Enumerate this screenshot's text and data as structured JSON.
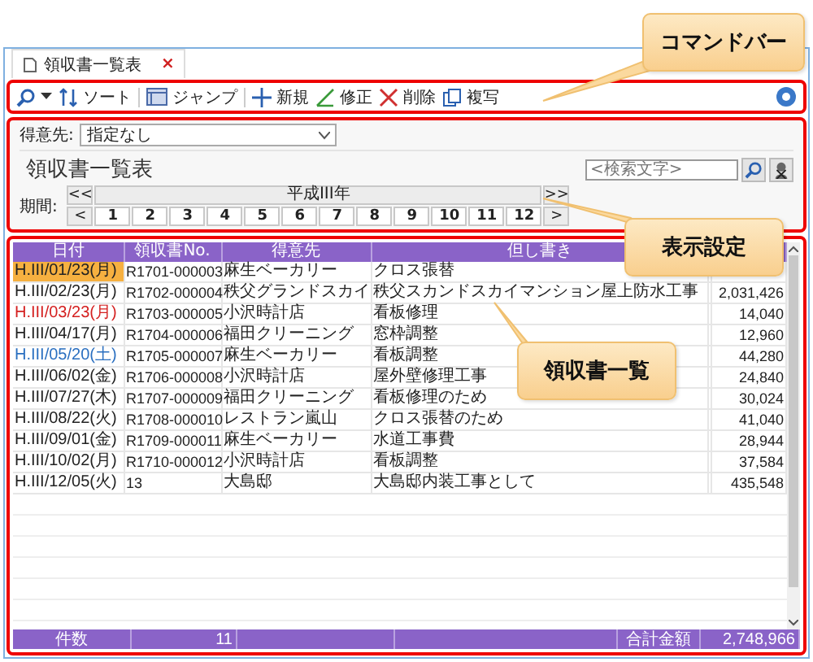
{
  "tab": {
    "title": "領収書一覧表",
    "close": "×"
  },
  "toolbar": {
    "items": [
      {
        "label": "ソート"
      },
      {
        "label": "ジャンプ"
      },
      {
        "label": "新規"
      },
      {
        "label": "修正"
      },
      {
        "label": "削除"
      },
      {
        "label": "複写"
      }
    ]
  },
  "filter": {
    "label": "得意先:",
    "value": "指定なし"
  },
  "title": "領収書一覧表",
  "search": {
    "placeholder": "<検索文字>"
  },
  "period": {
    "label": "期間:",
    "year": "平成III年",
    "first": "<<",
    "last": ">>",
    "prev": "<",
    "next": ">",
    "months": [
      "1",
      "2",
      "3",
      "4",
      "5",
      "6",
      "7",
      "8",
      "9",
      "10",
      "11",
      "12"
    ]
  },
  "table": {
    "columns": [
      "日付",
      "領収書No.",
      "得意先",
      "但し書き"
    ],
    "rows": [
      {
        "date": "H.III/01/23(月)",
        "number": "R1701-000003",
        "client": "麻生ベーカリー",
        "description": "クロス張替",
        "kind": "weekday",
        "selected": true
      },
      {
        "date": "H.III/02/23(月)",
        "number": "R1702-000004",
        "client": "秩父グランドスカイ",
        "description": "秩父スカンドスカイマンション屋上防水工事",
        "amount": "2,031,426",
        "kind": "weekday",
        "selected": false
      },
      {
        "date": "H.III/03/23(月)",
        "number": "R1703-000005",
        "client": "小沢時計店",
        "description": "看板修理",
        "amount": "14,040",
        "kind": "holiday",
        "selected": false
      },
      {
        "date": "H.III/04/17(月)",
        "number": "R1704-000006",
        "client": "福田クリーニング",
        "description": "窓枠調整",
        "amount": "12,960",
        "kind": "weekday",
        "selected": false
      },
      {
        "date": "H.III/05/20(土)",
        "number": "R1705-000007",
        "client": "麻生ベーカリー",
        "description": "看板調整",
        "amount": "44,280",
        "kind": "saturday",
        "selected": false
      },
      {
        "date": "H.III/06/02(金)",
        "number": "R1706-000008",
        "client": "小沢時計店",
        "description": "屋外壁修理工事",
        "amount": "24,840",
        "kind": "weekday",
        "selected": false
      },
      {
        "date": "H.III/07/27(木)",
        "number": "R1707-000009",
        "client": "福田クリーニング",
        "description": "看板修理のため",
        "amount": "30,024",
        "kind": "weekday",
        "selected": false
      },
      {
        "date": "H.III/08/22(火)",
        "number": "R1708-000010",
        "client": "レストラン嵐山",
        "description": "クロス張替のため",
        "amount": "41,040",
        "kind": "weekday",
        "selected": false
      },
      {
        "date": "H.III/09/01(金)",
        "number": "R1709-000011",
        "client": "麻生ベーカリー",
        "description": "水道工事費",
        "amount": "28,944",
        "kind": "weekday",
        "selected": false
      },
      {
        "date": "H.III/10/02(月)",
        "number": "R1710-000012",
        "client": "小沢時計店",
        "description": "看板調整",
        "amount": "37,584",
        "kind": "weekday",
        "selected": false
      },
      {
        "date": "H.III/12/05(火)",
        "number": "13",
        "client": "大島邸",
        "description": "大島邸内装工事として",
        "amount": "435,548",
        "kind": "weekday",
        "selected": false
      }
    ],
    "footer": {
      "count_label": "件数",
      "count": "11",
      "total_label": "合計金額",
      "total": "2,748,966"
    }
  },
  "callouts": [
    {
      "text": "コマンドバー"
    },
    {
      "text": "表示設定"
    },
    {
      "text": "領収書一覧"
    }
  ]
}
